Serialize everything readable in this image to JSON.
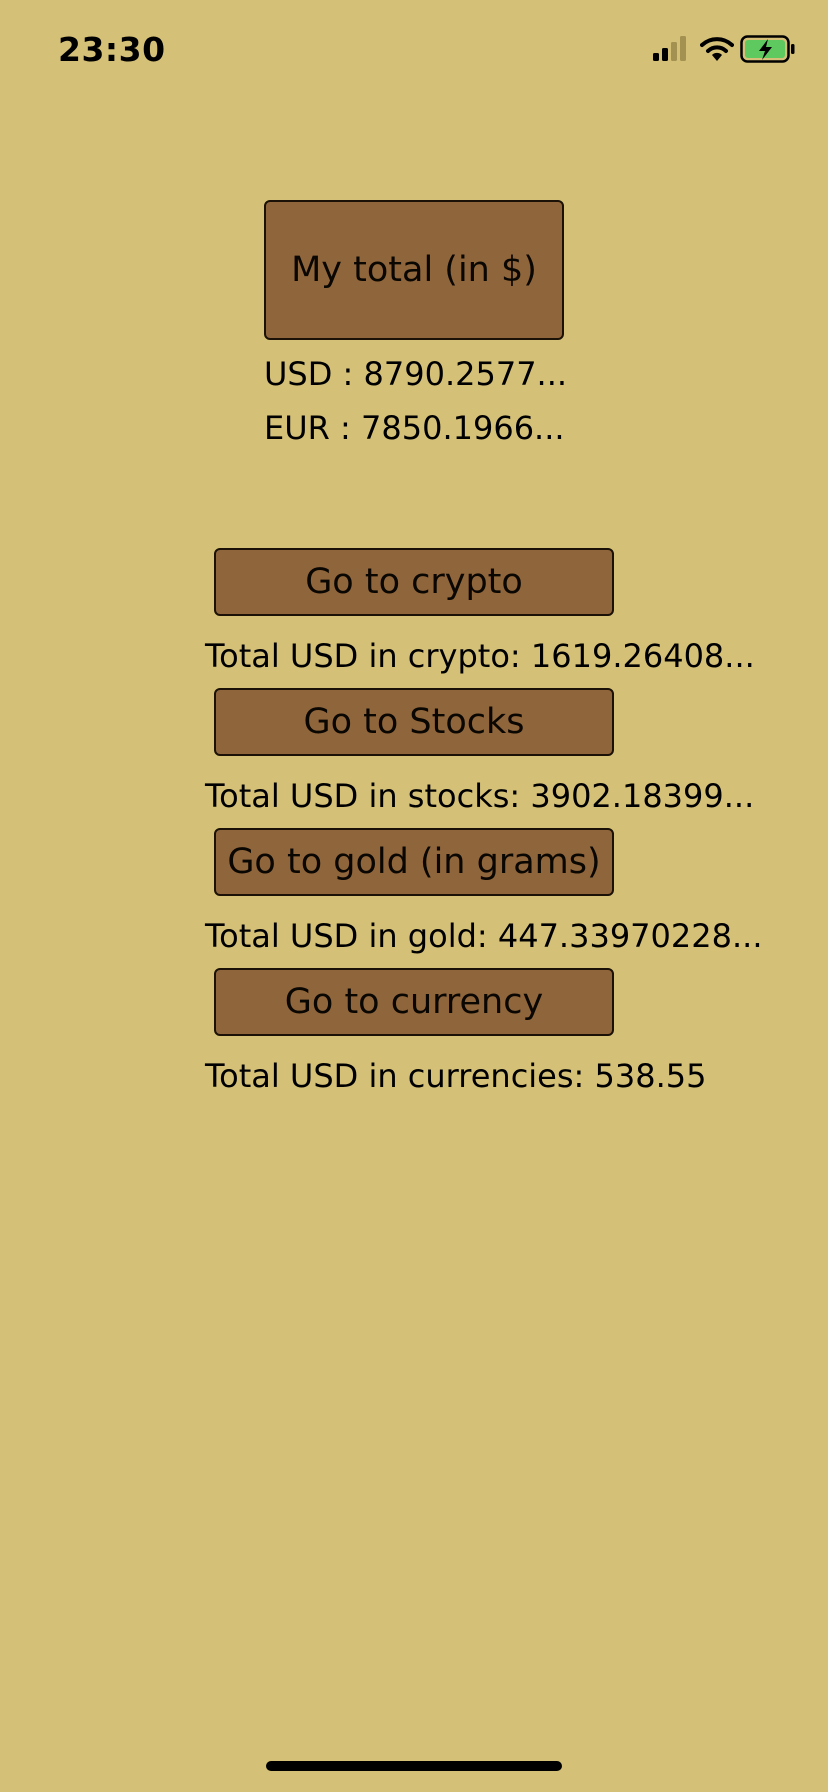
{
  "status_bar": {
    "time": "23:30",
    "icons": [
      "signal-icon",
      "wifi-icon",
      "battery-charging-icon"
    ],
    "battery_color": "#5ec95e"
  },
  "summary": {
    "total_button_label": "My total (in $)",
    "usd_line": "USD : 8790.2577...",
    "eur_line": "EUR : 7850.1966..."
  },
  "sections": [
    {
      "button_label": "Go to crypto",
      "total_text": "Total USD in crypto: 1619.26408..."
    },
    {
      "button_label": "Go to Stocks",
      "total_text": "Total USD in stocks: 3902.18399..."
    },
    {
      "button_label": "Go to gold (in grams)",
      "total_text": "Total USD in gold: 447.33970228..."
    },
    {
      "button_label": "Go to currency",
      "total_text": "Total USD in currencies: 538.55"
    }
  ],
  "colors": {
    "background": "#d4c077",
    "button_fill": "#8f653b",
    "button_border": "#1b1106"
  }
}
